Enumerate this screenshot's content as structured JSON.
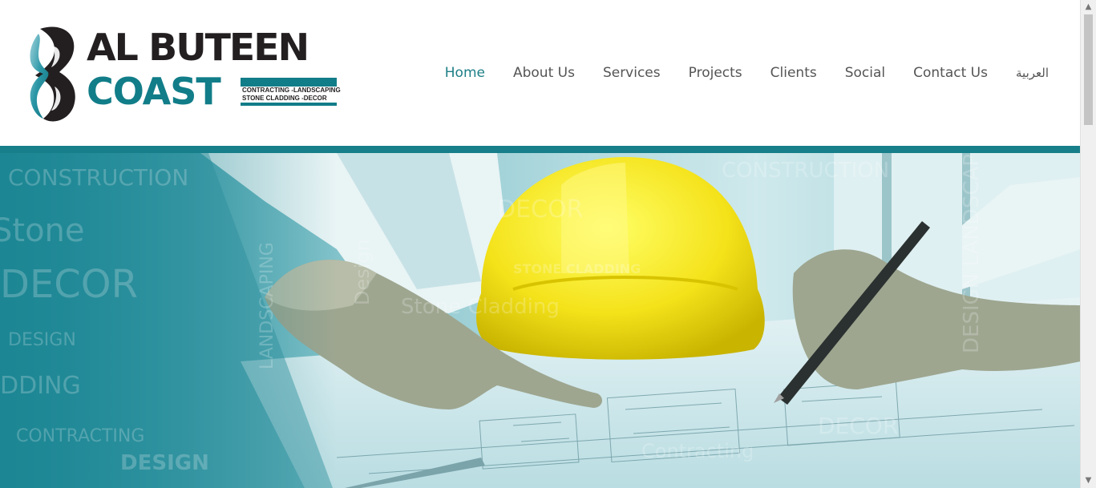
{
  "brand": {
    "line1": "AL BUTEEN",
    "line2": "COAST",
    "tagline_1": "CONTRACTING -LANDSCAPING",
    "tagline_2": "STONE CLADDING -DECOR",
    "colors": {
      "teal": "#117d88",
      "dark": "#231f20"
    }
  },
  "nav": {
    "items": [
      {
        "label": "Home",
        "active": true
      },
      {
        "label": "About Us"
      },
      {
        "label": "Services"
      },
      {
        "label": "Projects"
      },
      {
        "label": "Clients"
      },
      {
        "label": "Social"
      },
      {
        "label": "Contact Us"
      },
      {
        "label": "العربية"
      }
    ]
  },
  "hero": {
    "watermark_words": [
      "CONSTRUCTION",
      "DESIGN",
      "DECOR",
      "STONE CLADDING",
      "LANDSCAPING",
      "Contracting",
      "Stone Cladding",
      "Design"
    ]
  },
  "icons": [
    "scroll-up-icon",
    "scroll-down-icon",
    "logo-mark-icon"
  ]
}
